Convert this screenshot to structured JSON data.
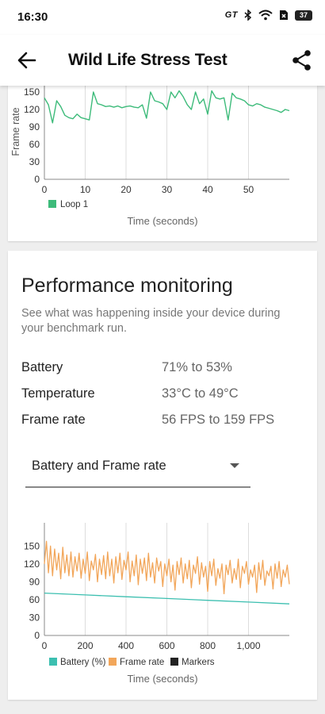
{
  "status_bar": {
    "time": "16:30",
    "carrier_badge": "GT",
    "battery_level": "37"
  },
  "app_bar": {
    "title": "Wild Life Stress Test"
  },
  "loop_chart": {
    "y_axis_label": "Frame rate",
    "x_axis_label": "Time (seconds)",
    "legend": [
      {
        "label": "Loop 1",
        "color": "#3dbb7a"
      }
    ]
  },
  "performance": {
    "title": "Performance monitoring",
    "description": "See what was happening inside your device during your benchmark run.",
    "rows": [
      {
        "label": "Battery",
        "value": "71% to 53%"
      },
      {
        "label": "Temperature",
        "value": "33°C to 49°C"
      },
      {
        "label": "Frame rate",
        "value": "56 FPS to 159 FPS"
      }
    ],
    "dropdown": {
      "selected": "Battery and Frame rate"
    }
  },
  "combined_chart": {
    "x_axis_label": "Time (seconds)",
    "legend": [
      {
        "label": "Battery (%)",
        "color": "#3cbfb0"
      },
      {
        "label": "Frame rate",
        "color": "#f2a65a"
      },
      {
        "label": "Markers",
        "color": "#222222"
      }
    ]
  },
  "chart_data": [
    {
      "type": "line",
      "xlabel": "Time (seconds)",
      "ylabel": "Frame rate",
      "xlim": [
        0,
        60
      ],
      "ylim": [
        0,
        150
      ],
      "xticks": [
        0,
        10,
        20,
        30,
        40,
        50
      ],
      "yticks": [
        0,
        30,
        60,
        90,
        120,
        150
      ],
      "grid": "vertical",
      "legend_position": "bottom-left",
      "series": [
        {
          "name": "Loop 1",
          "color": "#3dbb7a",
          "x": [
            0,
            1,
            2,
            3,
            4,
            5,
            6,
            7,
            8,
            9,
            10,
            11,
            12,
            13,
            14,
            15,
            16,
            17,
            18,
            19,
            20,
            21,
            22,
            23,
            24,
            25,
            26,
            27,
            28,
            29,
            30,
            31,
            32,
            33,
            34,
            35,
            36,
            37,
            38,
            39,
            40,
            41,
            42,
            43,
            44,
            45,
            46,
            47,
            48,
            49,
            50,
            51,
            52,
            53,
            54,
            55,
            56,
            57,
            58,
            59,
            60
          ],
          "y": [
            140,
            128,
            97,
            135,
            125,
            110,
            106,
            104,
            112,
            106,
            104,
            102,
            150,
            130,
            128,
            125,
            126,
            124,
            126,
            123,
            125,
            126,
            124,
            123,
            128,
            105,
            150,
            135,
            133,
            130,
            120,
            150,
            140,
            152,
            142,
            128,
            120,
            150,
            130,
            138,
            112,
            152,
            140,
            138,
            140,
            102,
            148,
            140,
            138,
            135,
            128,
            126,
            130,
            128,
            124,
            122,
            120,
            118,
            115,
            120,
            118
          ]
        }
      ]
    },
    {
      "type": "line",
      "xlabel": "Time (seconds)",
      "xlim": [
        0,
        1200
      ],
      "ylim": [
        0,
        165
      ],
      "xticks": [
        0,
        200,
        400,
        600,
        800,
        1000
      ],
      "xtick_labels": [
        "0",
        "200",
        "400",
        "600",
        "800",
        "1,000"
      ],
      "yticks": [
        0,
        30,
        60,
        90,
        120,
        150
      ],
      "grid": "vertical",
      "legend_position": "bottom-left",
      "series": [
        {
          "name": "Battery (%)",
          "color": "#3cbfb0",
          "x": [
            0,
            200,
            400,
            600,
            800,
            1000,
            1200
          ],
          "y": [
            71,
            68,
            65,
            62,
            59,
            56,
            53
          ]
        },
        {
          "name": "Frame rate",
          "color": "#f2a65a",
          "x": [
            0,
            10,
            20,
            30,
            40,
            50,
            60,
            70,
            80,
            90,
            100,
            110,
            120,
            130,
            140,
            150,
            160,
            170,
            180,
            190,
            200,
            210,
            220,
            230,
            240,
            250,
            260,
            270,
            280,
            290,
            300,
            310,
            320,
            330,
            340,
            350,
            360,
            370,
            380,
            390,
            400,
            410,
            420,
            430,
            440,
            450,
            460,
            470,
            480,
            490,
            500,
            510,
            520,
            530,
            540,
            550,
            560,
            570,
            580,
            590,
            600,
            610,
            620,
            630,
            640,
            650,
            660,
            670,
            680,
            690,
            700,
            710,
            720,
            730,
            740,
            750,
            760,
            770,
            780,
            790,
            800,
            810,
            820,
            830,
            840,
            850,
            860,
            870,
            880,
            890,
            900,
            910,
            920,
            930,
            940,
            950,
            960,
            970,
            980,
            990,
            1000,
            1010,
            1020,
            1030,
            1040,
            1050,
            1060,
            1070,
            1080,
            1090,
            1100,
            1110,
            1120,
            1130,
            1140,
            1150,
            1160,
            1170,
            1180,
            1190,
            1200
          ],
          "y": [
            120,
            158,
            105,
            150,
            100,
            145,
            110,
            138,
            95,
            148,
            105,
            135,
            100,
            140,
            98,
            132,
            108,
            138,
            96,
            128,
            104,
            140,
            92,
            125,
            110,
            136,
            90,
            128,
            102,
            134,
            95,
            140,
            100,
            128,
            88,
            132,
            105,
            138,
            94,
            126,
            110,
            140,
            90,
            125,
            100,
            135,
            85,
            128,
            104,
            130,
            92,
            138,
            98,
            122,
            88,
            130,
            108,
            124,
            82,
            120,
            100,
            128,
            90,
            118,
            76,
            124,
            102,
            130,
            88,
            120,
            95,
            126,
            80,
            118,
            104,
            132,
            86,
            122,
            98,
            116,
            74,
            124,
            100,
            128,
            84,
            112,
            96,
            120,
            70,
            118,
            102,
            126,
            88,
            112,
            94,
            128,
            80,
            116,
            104,
            124,
            86,
            110,
            98,
            118,
            72,
            122,
            94,
            126,
            84,
            108,
            100,
            116,
            78,
            120,
            96,
            124,
            82,
            110,
            98,
            118,
            86
          ]
        },
        {
          "name": "Markers",
          "color": "#222222",
          "x": [],
          "y": []
        }
      ]
    }
  ]
}
